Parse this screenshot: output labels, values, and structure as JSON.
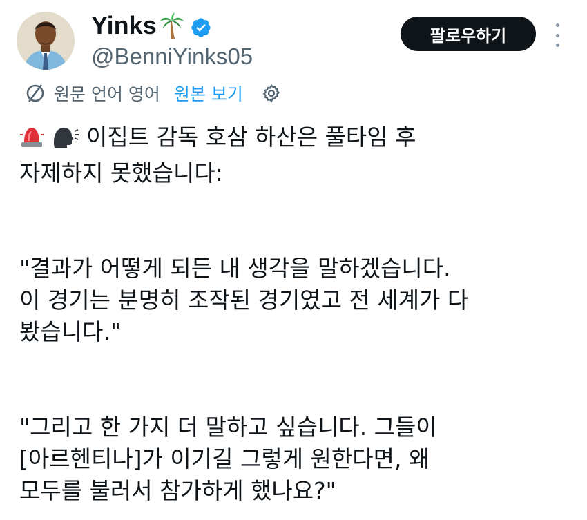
{
  "author": {
    "display_name": "Yinks",
    "handle": "@BenniYinks05",
    "name_emoji": "palm-tree-icon",
    "verified_icon": "verified-badge-icon"
  },
  "actions": {
    "follow_label": "팔로우하기",
    "more_icon": "more-vertical-icon"
  },
  "translation": {
    "source_language": "원문 언어 영어",
    "show_original": "원본 보기",
    "globe_icon": "translate-globe-icon",
    "settings_icon": "gear-icon"
  },
  "tweet": {
    "lead_emojis": [
      "police-siren-icon",
      "speaking-head-icon"
    ],
    "line1": "이집트 감독 호삼 하산은 풀타임 후",
    "line2": "자제하지 못했습니다:",
    "quote1_line1": "\"결과가 어떻게 되든 내 생각을 말하겠습니다.",
    "quote1_line2": "이 경기는 분명히 조작된 경기였고 전 세계가 다",
    "quote1_line3": "봤습니다.\"",
    "quote2_line1": "\"그리고 한 가지 더 말하고 싶습니다. 그들이",
    "quote2_line2": "[아르헨티나]가 이기길 그렇게 원한다면, 왜",
    "quote2_line3": "모두를 불러서 참가하게 했나요?\""
  },
  "colors": {
    "text": "#0f1419",
    "secondary": "#536471",
    "link": "#1d9bf0",
    "follow_bg": "#0f1419"
  }
}
